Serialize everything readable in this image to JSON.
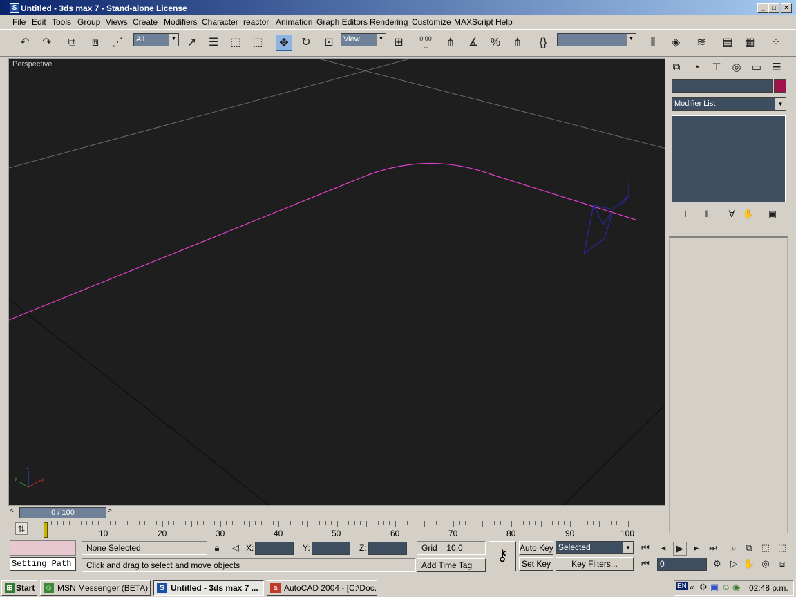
{
  "window": {
    "title": "Untitled - 3ds max 7  - Stand-alone License",
    "app_icon": "3dsmax-icon",
    "min": "_",
    "max": "□",
    "close": "×"
  },
  "menu": [
    "File",
    "Edit",
    "Tools",
    "Group",
    "Views",
    "Create",
    "Modifiers",
    "Character",
    "reactor",
    "Animation",
    "Graph Editors",
    "Rendering",
    "Customize",
    "MAXScript",
    "Help"
  ],
  "toolbar": {
    "selection_filter": "All",
    "ref_coord": "View",
    "named_selection": "",
    "spinner_snap": "0,00"
  },
  "viewport": {
    "label": "Perspective",
    "axis_x": "x",
    "axis_y": "y",
    "axis_z": "z",
    "colors": {
      "spline": "#e040c8",
      "object": "#2828a0",
      "grid": "#6a6a6a",
      "bg": "#1e1e1e"
    }
  },
  "panel": {
    "modifier_list": "Modifier List",
    "object_color": "#a0134a"
  },
  "time": {
    "slider": "0 / 100",
    "ticks": [
      "10",
      "20",
      "30",
      "40",
      "50",
      "60",
      "70",
      "80",
      "90",
      "100"
    ]
  },
  "status": {
    "maxscript": "Setting Path",
    "selection": "None Selected",
    "x_label": "X:",
    "y_label": "Y:",
    "z_label": "Z:",
    "x": "",
    "y": "",
    "z": "",
    "grid": "Grid = 10,0",
    "prompt": "Click and drag to select and move objects",
    "add_time_tag": "Add Time Tag",
    "auto_key": "Auto Key",
    "set_key": "Set Key",
    "key_mode": "Selected",
    "key_filters": "Key Filters...",
    "frame": "0"
  },
  "taskbar": {
    "start": "Start",
    "tasks": [
      "MSN Messenger (BETA)",
      "Untitled - 3ds max 7 ...",
      "AutoCAD 2004 - [C:\\Doc..."
    ],
    "lang": "EN",
    "tray_arrows": "«",
    "clock": "02:48 p.m."
  }
}
